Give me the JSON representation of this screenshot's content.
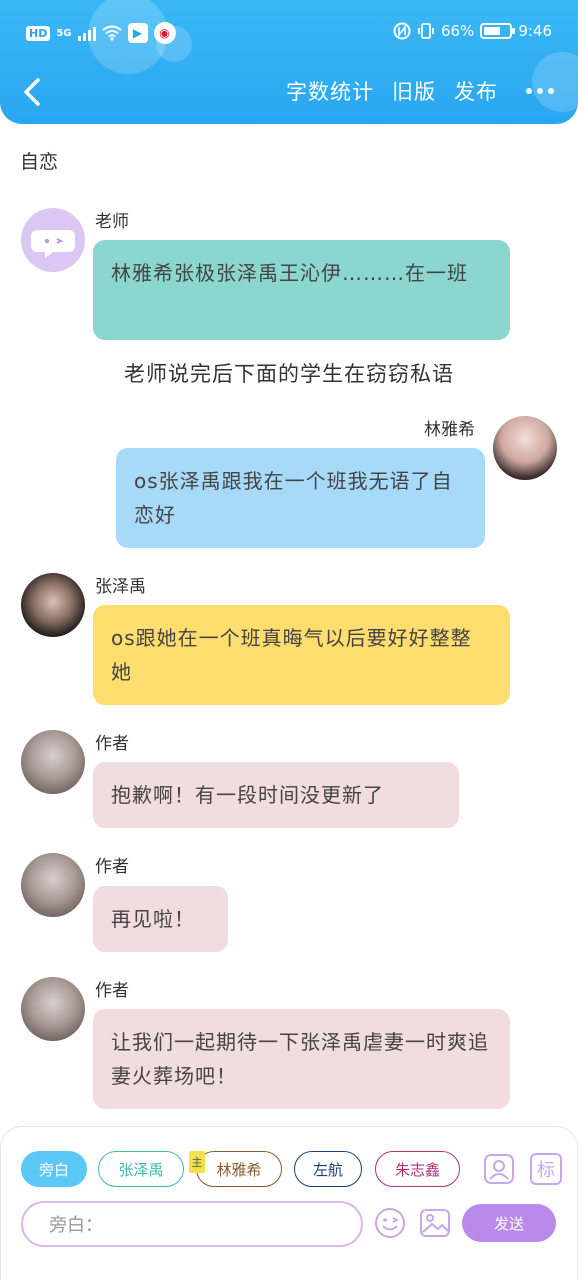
{
  "status_bar": {
    "hd": "HD",
    "network": "5G",
    "battery": "66%",
    "battery_level": 0.66,
    "time": "9:46"
  },
  "nav": {
    "links": [
      "字数统计",
      "旧版",
      "发布"
    ]
  },
  "chat_title": "自恋",
  "messages": [
    {
      "speaker": "老师",
      "text": "林雅希张极张泽禹王沁伊………在一班",
      "bubble_color": "#8bd6cf"
    },
    {
      "speaker": "林雅希",
      "text": "os张泽禹跟我在一个班我无语了自恋好",
      "bubble_color": "#a7d9f8"
    },
    {
      "speaker": "张泽禹",
      "text": "os跟她在一个班真晦气以后要好好整整她",
      "bubble_color": "#ffdd6e"
    },
    {
      "speaker": "作者",
      "text": "抱歉啊！有一段时间没更新了",
      "bubble_color": "#f1dcdf"
    },
    {
      "speaker": "作者",
      "text": "再见啦！",
      "bubble_color": "#f1dcdf"
    },
    {
      "speaker": "作者",
      "text": "让我们一起期待一下张泽禹虐妻一时爽追妻火葬场吧！",
      "bubble_color": "#f1dcdf"
    }
  ],
  "narration": "老师说完后下面的学生在窃窃私语",
  "input_bar": {
    "roles": [
      {
        "label": "旁白",
        "color": "#5cc8f5"
      },
      {
        "label": "张泽禹",
        "color": "#3fb8ad"
      },
      {
        "label": "林雅希",
        "color": "#8a5a2e"
      },
      {
        "label": "左航",
        "color": "#1c3d7a"
      },
      {
        "label": "朱志鑫",
        "color": "#b0327a"
      }
    ],
    "lead_tag": "主",
    "mark_label": "标",
    "placeholder": "旁白：",
    "send_label": "发送"
  }
}
